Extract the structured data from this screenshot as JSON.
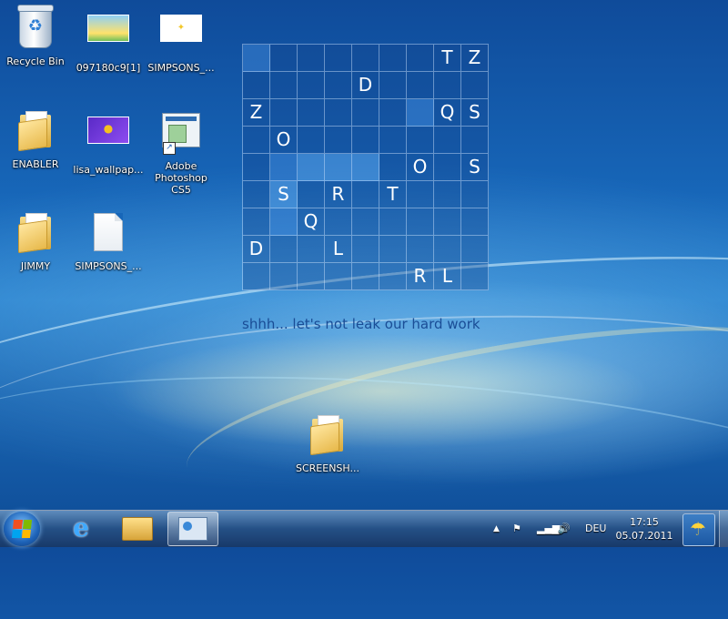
{
  "desktop": {
    "icons": [
      {
        "label": "Recycle Bin",
        "icon": "recycle-bin-icon"
      },
      {
        "label": "097180c9[1]",
        "icon": "image-thumbnail-icon"
      },
      {
        "label": "SIMPSONS_...",
        "icon": "image-thumbnail-icon"
      },
      {
        "label": "ENABLER",
        "icon": "folder-icon"
      },
      {
        "label": "lisa_wallpap...",
        "icon": "image-thumbnail-icon"
      },
      {
        "label": "Adobe Photoshop CS5",
        "icon": "photoshop-shortcut-icon"
      },
      {
        "label": "JIMMY",
        "icon": "folder-icon"
      },
      {
        "label": "SIMPSONS_...",
        "icon": "text-document-icon"
      },
      {
        "label": "SCREENSH...",
        "icon": "folder-icon"
      }
    ]
  },
  "puzzle": {
    "rows": [
      [
        "",
        "",
        "",
        "",
        "",
        "",
        "",
        "T",
        "Z"
      ],
      [
        "",
        "",
        "",
        "",
        "D",
        "",
        "",
        "",
        ""
      ],
      [
        "Z",
        "",
        "",
        "",
        "",
        "",
        "",
        "Q",
        "S"
      ],
      [
        "",
        "O",
        "",
        "",
        "",
        "",
        "",
        "",
        ""
      ],
      [
        "",
        "",
        "",
        "",
        "",
        "",
        "O",
        "",
        "S"
      ],
      [
        "",
        "S",
        "",
        "R",
        "",
        "T",
        "",
        "",
        ""
      ],
      [
        "",
        "",
        "Q",
        "",
        "",
        "",
        "",
        "",
        ""
      ],
      [
        "D",
        "",
        "",
        "L",
        "",
        "",
        "",
        "",
        ""
      ],
      [
        "",
        "",
        "",
        "",
        "",
        "",
        "R",
        "L",
        ""
      ]
    ],
    "tagline": "shhh... let's not leak our hard work"
  },
  "taskbar": {
    "start_icon": "windows-start-icon",
    "pinned": [
      {
        "name": "internet-explorer-icon"
      },
      {
        "name": "windows-explorer-icon"
      },
      {
        "name": "desktop-gadget-icon"
      }
    ],
    "tray": {
      "language": "DEU",
      "time": "17:15",
      "date": "05.07.2011"
    }
  }
}
